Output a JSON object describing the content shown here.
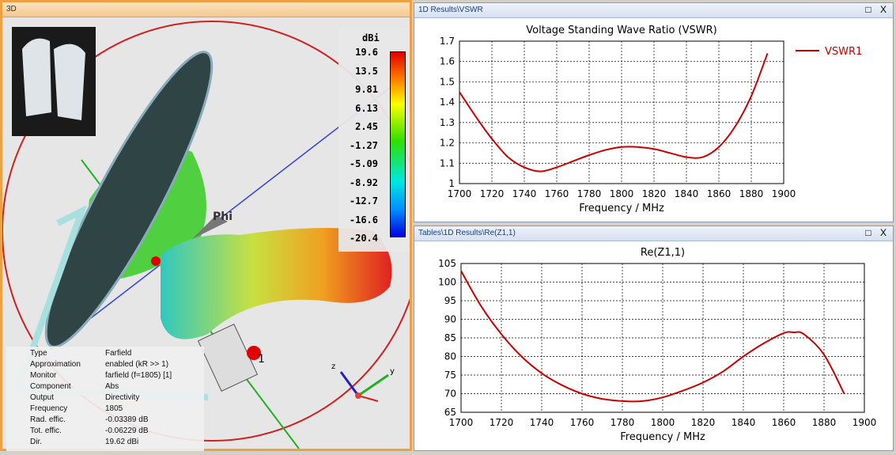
{
  "panel3d": {
    "title": "3D",
    "axis_label": "Phi",
    "port_label": "1",
    "colorbar": {
      "unit": "dBi",
      "ticks": [
        "19.6",
        "13.5",
        "9.81",
        "6.13",
        "2.45",
        "-1.27",
        "-5.09",
        "-8.92",
        "-12.7",
        "-16.6",
        "-20.4"
      ]
    },
    "triad": {
      "x": "x",
      "y": "y",
      "z": "z"
    },
    "info": [
      [
        "Type",
        "Farfield"
      ],
      [
        "Approximation",
        "enabled (kR >> 1)"
      ],
      [
        "Monitor",
        "farfield (f=1805) [1]"
      ],
      [
        "Component",
        "Abs"
      ],
      [
        "Output",
        "Directivity"
      ],
      [
        "Frequency",
        "1805"
      ],
      [
        "Rad. effic.",
        "-0.03389 dB"
      ],
      [
        "Tot. effic.",
        "-0.06229 dB"
      ],
      [
        "Dir.",
        "19.62 dBi"
      ]
    ]
  },
  "window_buttons": "□ X",
  "chart_data": [
    {
      "panel_title": "1D Results\\VSWR",
      "type": "line",
      "title": "Voltage Standing Wave Ratio (VSWR)",
      "xlabel": "Frequency / MHz",
      "ylabel": "",
      "xlim": [
        1700,
        1900
      ],
      "ylim": [
        1,
        1.7
      ],
      "xticks": [
        1700,
        1720,
        1740,
        1760,
        1780,
        1800,
        1820,
        1840,
        1860,
        1880,
        1900
      ],
      "yticks": [
        1,
        1.1,
        1.2,
        1.3,
        1.4,
        1.5,
        1.6,
        1.7
      ],
      "grid": true,
      "legend": "top-right",
      "color": "#cc0000",
      "series": [
        {
          "name": "VSWR1",
          "x": [
            1700,
            1710,
            1720,
            1730,
            1740,
            1750,
            1760,
            1770,
            1780,
            1790,
            1800,
            1810,
            1820,
            1830,
            1840,
            1850,
            1860,
            1870,
            1880,
            1890
          ],
          "values": [
            1.45,
            1.33,
            1.22,
            1.13,
            1.08,
            1.06,
            1.08,
            1.11,
            1.14,
            1.165,
            1.18,
            1.18,
            1.17,
            1.15,
            1.13,
            1.13,
            1.18,
            1.28,
            1.43,
            1.64
          ]
        }
      ]
    },
    {
      "panel_title": "Tables\\1D Results\\Re(Z1,1)",
      "type": "line",
      "title": "Re(Z1,1)",
      "xlabel": "Frequency / MHz",
      "ylabel": "",
      "xlim": [
        1700,
        1900
      ],
      "ylim": [
        65,
        105
      ],
      "xticks": [
        1700,
        1720,
        1740,
        1760,
        1780,
        1800,
        1820,
        1840,
        1860,
        1880,
        1900
      ],
      "yticks": [
        65,
        70,
        75,
        80,
        85,
        90,
        95,
        100,
        105
      ],
      "grid": true,
      "legend": "none",
      "color": "#cc0000",
      "series": [
        {
          "name": "Re(Z1,1)",
          "x": [
            1700,
            1710,
            1720,
            1730,
            1740,
            1750,
            1760,
            1770,
            1780,
            1790,
            1800,
            1810,
            1820,
            1830,
            1840,
            1850,
            1860,
            1865,
            1870,
            1880,
            1890
          ],
          "values": [
            103,
            93.5,
            86,
            80,
            75.5,
            72.3,
            70,
            68.6,
            68,
            68,
            69,
            70.8,
            73,
            76,
            80,
            83.5,
            86.3,
            86.5,
            86,
            80.5,
            70
          ]
        }
      ]
    }
  ]
}
